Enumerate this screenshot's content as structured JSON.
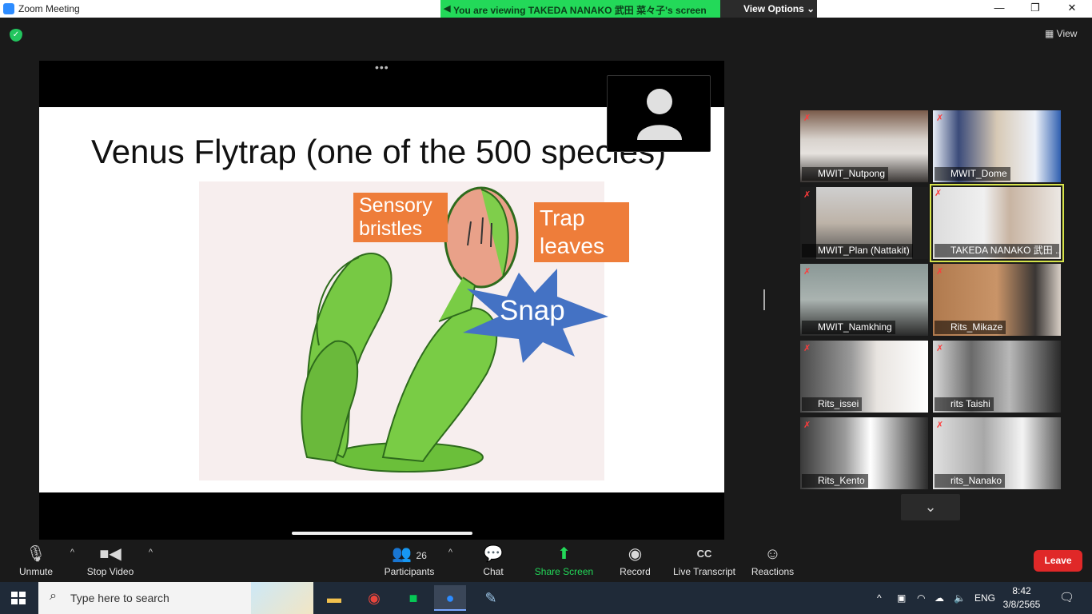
{
  "window": {
    "title": "Zoom Meeting",
    "banner": "You are viewing TAKEDA NANAKO 武田 菜々子's screen",
    "view_options": "View Options",
    "minimize": "—",
    "restore": "❐",
    "close": "✕",
    "view_label": "View"
  },
  "slide": {
    "title": "Venus Flytrap (one of the 500 species)",
    "label_sensory": "Sensory bristles",
    "label_trap": "Trap leaves",
    "label_snap": "Snap"
  },
  "participants": [
    {
      "name": "MWIT_Nutpong"
    },
    {
      "name": "MWIT_Dome"
    },
    {
      "name": "MWIT_Plan (Nattakit)"
    },
    {
      "name": "TAKEDA NANAKO 武田 ..."
    },
    {
      "name": "MWIT_Namkhing"
    },
    {
      "name": "Rits_Mikaze"
    },
    {
      "name": "Rits_issei"
    },
    {
      "name": "rits Taishi"
    },
    {
      "name": "Rits_Kento"
    },
    {
      "name": "rits_Nanako"
    }
  ],
  "toolbar": {
    "unmute": "Unmute",
    "stop_video": "Stop Video",
    "participants_label": "Participants",
    "participants_count": "26",
    "chat": "Chat",
    "share_screen": "Share Screen",
    "record": "Record",
    "live_transcript": "Live Transcript",
    "reactions": "Reactions",
    "leave": "Leave"
  },
  "taskbar": {
    "search_placeholder": "Type here to search",
    "language": "ENG",
    "time": "8:42",
    "date": "3/8/2565"
  }
}
